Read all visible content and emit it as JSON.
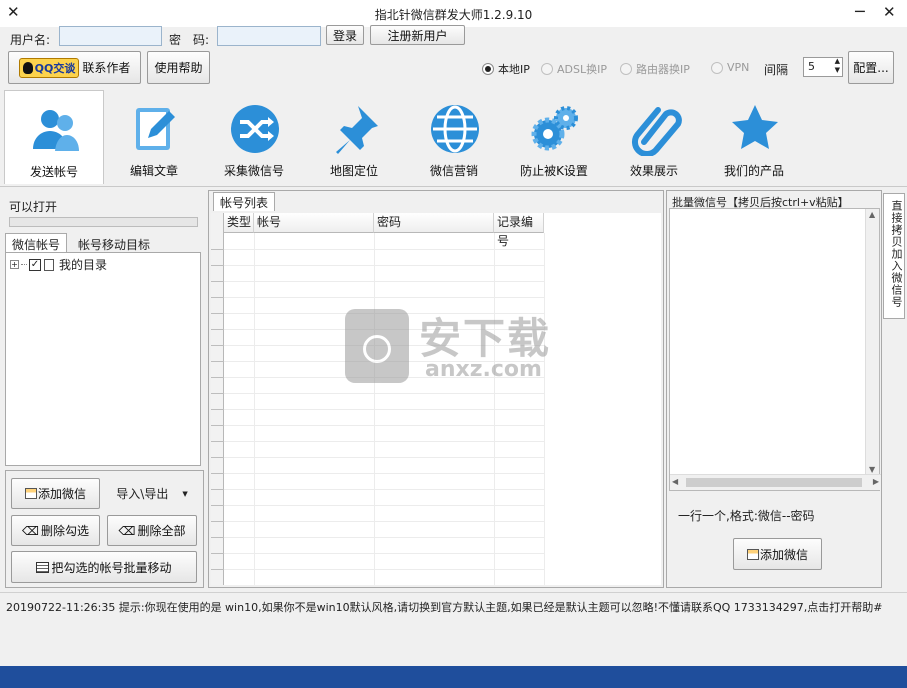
{
  "window": {
    "title": "指北针微信群发大师1.2.9.10"
  },
  "login": {
    "username_label": "用户名:",
    "password_label": "密　码:",
    "username_value": "",
    "password_value": "",
    "login_button": "登录",
    "register_button": "注册新用户"
  },
  "toolbar": {
    "qq_badge": "QQ交谈",
    "contact_label": "联系作者",
    "help_button": "使用帮助",
    "ip_options": [
      {
        "label": "本地IP",
        "selected": true,
        "enabled": true
      },
      {
        "label": "ADSL换IP",
        "selected": false,
        "enabled": false
      },
      {
        "label": "路由器换IP",
        "selected": false,
        "enabled": false
      },
      {
        "label": "VPN",
        "selected": false,
        "enabled": false
      }
    ],
    "interval_label": "间隔",
    "interval_value": "5",
    "config_button": "配置..."
  },
  "tools": [
    {
      "label": "发送帐号",
      "icon": "users-icon",
      "selected": true
    },
    {
      "label": "编辑文章",
      "icon": "edit-icon",
      "selected": false
    },
    {
      "label": "采集微信号",
      "icon": "shuffle-icon",
      "selected": false
    },
    {
      "label": "地图定位",
      "icon": "pushpin-icon",
      "selected": false
    },
    {
      "label": "微信营销",
      "icon": "globe-icon",
      "selected": false
    },
    {
      "label": "防止被K设置",
      "icon": "gears-icon",
      "selected": false
    },
    {
      "label": "效果展示",
      "icon": "paperclip-icon",
      "selected": false
    },
    {
      "label": "我们的产品",
      "icon": "star-icon",
      "selected": false
    }
  ],
  "left": {
    "status_label": "可以打开",
    "tabs": [
      "微信帐号",
      "帐号移动目标"
    ],
    "tree_root": "我的目录",
    "tree_root_checked": true,
    "add_wechat_button": "添加微信",
    "import_export_button": "导入\\导出",
    "delete_checked_button": "删除勾选",
    "delete_all_button": "删除全部",
    "batch_move_button": "把勾选的帐号批量移动"
  },
  "center": {
    "tab_label": "帐号列表",
    "columns": [
      "类型",
      "帐号",
      "密码",
      "记录编号"
    ]
  },
  "right": {
    "header": "批量微信号【拷贝后按ctrl+v粘贴】",
    "hint": "一行一个,格式:微信--密码",
    "add_wechat_button": "添加微信",
    "side_tab": "直接拷贝加入微信号"
  },
  "watermark": {
    "text": "安下载",
    "sub": "anxz.com"
  },
  "status_bar": {
    "text": "20190722-11:26:35  提示:你现在使用的是 win10,如果你不是win10默认风格,请切换到官方默认主题,如果已经是默认主题可以忽略!不懂请联系QQ 1733134297,点击打开帮助#"
  },
  "colors": {
    "accent": "#2c8fd8",
    "taskbar": "#1f4e9c"
  }
}
